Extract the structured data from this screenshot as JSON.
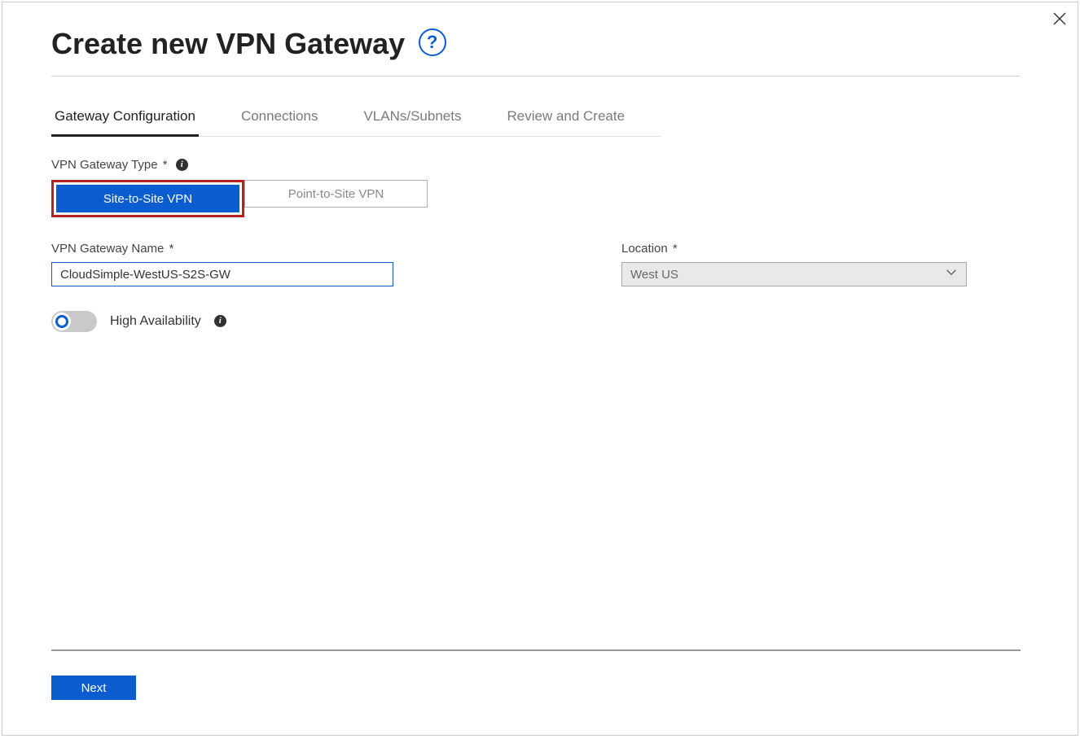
{
  "header": {
    "title": "Create new VPN Gateway"
  },
  "tabs": [
    {
      "label": "Gateway Configuration",
      "active": true
    },
    {
      "label": "Connections",
      "active": false
    },
    {
      "label": "VLANs/Subnets",
      "active": false
    },
    {
      "label": "Review and Create",
      "active": false
    }
  ],
  "gateway_type": {
    "label": "VPN Gateway Type",
    "options": {
      "site_to_site": "Site-to-Site VPN",
      "point_to_site": "Point-to-Site VPN"
    },
    "selected": "site_to_site"
  },
  "gateway_name": {
    "label": "VPN Gateway Name",
    "value": "CloudSimple-WestUS-S2S-GW"
  },
  "location": {
    "label": "Location",
    "value": "West US"
  },
  "high_availability": {
    "label": "High Availability",
    "enabled": false
  },
  "footer": {
    "next_label": "Next"
  }
}
